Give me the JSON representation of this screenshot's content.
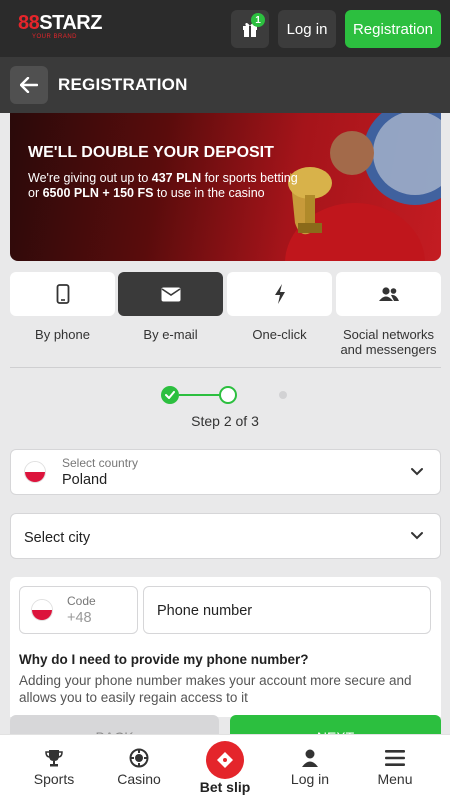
{
  "header": {
    "logo_text_prefix": "8",
    "logo_text_mid": "8",
    "logo_text_main": "STARZ",
    "logo_tagline": "YOUR BRAND",
    "gift_badge_count": "1",
    "login_label": "Log in",
    "registration_label": "Registration"
  },
  "titlebar": {
    "title": "REGISTRATION"
  },
  "banner": {
    "title": "WE'LL DOUBLE YOUR DEPOSIT",
    "line1_pre": "We're giving out up to ",
    "line1_bold": "437 PLN",
    "line1_post": " for sports betting",
    "line2_pre": "or ",
    "line2_bold": "6500 PLN + 150 FS",
    "line2_post": " to use in the casino"
  },
  "methods": [
    {
      "label": "By phone",
      "icon": "phone-icon",
      "active": false
    },
    {
      "label": "By e-mail",
      "icon": "envelope-icon",
      "active": true
    },
    {
      "label": "One-click",
      "icon": "lightning-icon",
      "active": false
    },
    {
      "label": "Social networks and messengers",
      "icon": "users-icon",
      "active": false
    }
  ],
  "stepper": {
    "text": "Step 2 of 3",
    "current": 2,
    "total": 3
  },
  "country": {
    "label": "Select country",
    "value": "Poland"
  },
  "city": {
    "placeholder": "Select city"
  },
  "phone": {
    "code_label": "Code",
    "code_value": "+48",
    "number_placeholder": "Phone number",
    "why_title": "Why do I need to provide my phone number?",
    "why_text": "Adding your phone number makes your account more secure and allows you to easily regain access to it"
  },
  "actions": {
    "back_label": "BACK",
    "next_label": "NEXT"
  },
  "bottom_nav": {
    "sports": "Sports",
    "casino": "Casino",
    "betslip": "Bet slip",
    "login": "Log in",
    "menu": "Menu"
  },
  "colors": {
    "accent_green": "#2cbf3f",
    "brand_red": "#e4252b",
    "dark": "#2b2b2b"
  }
}
